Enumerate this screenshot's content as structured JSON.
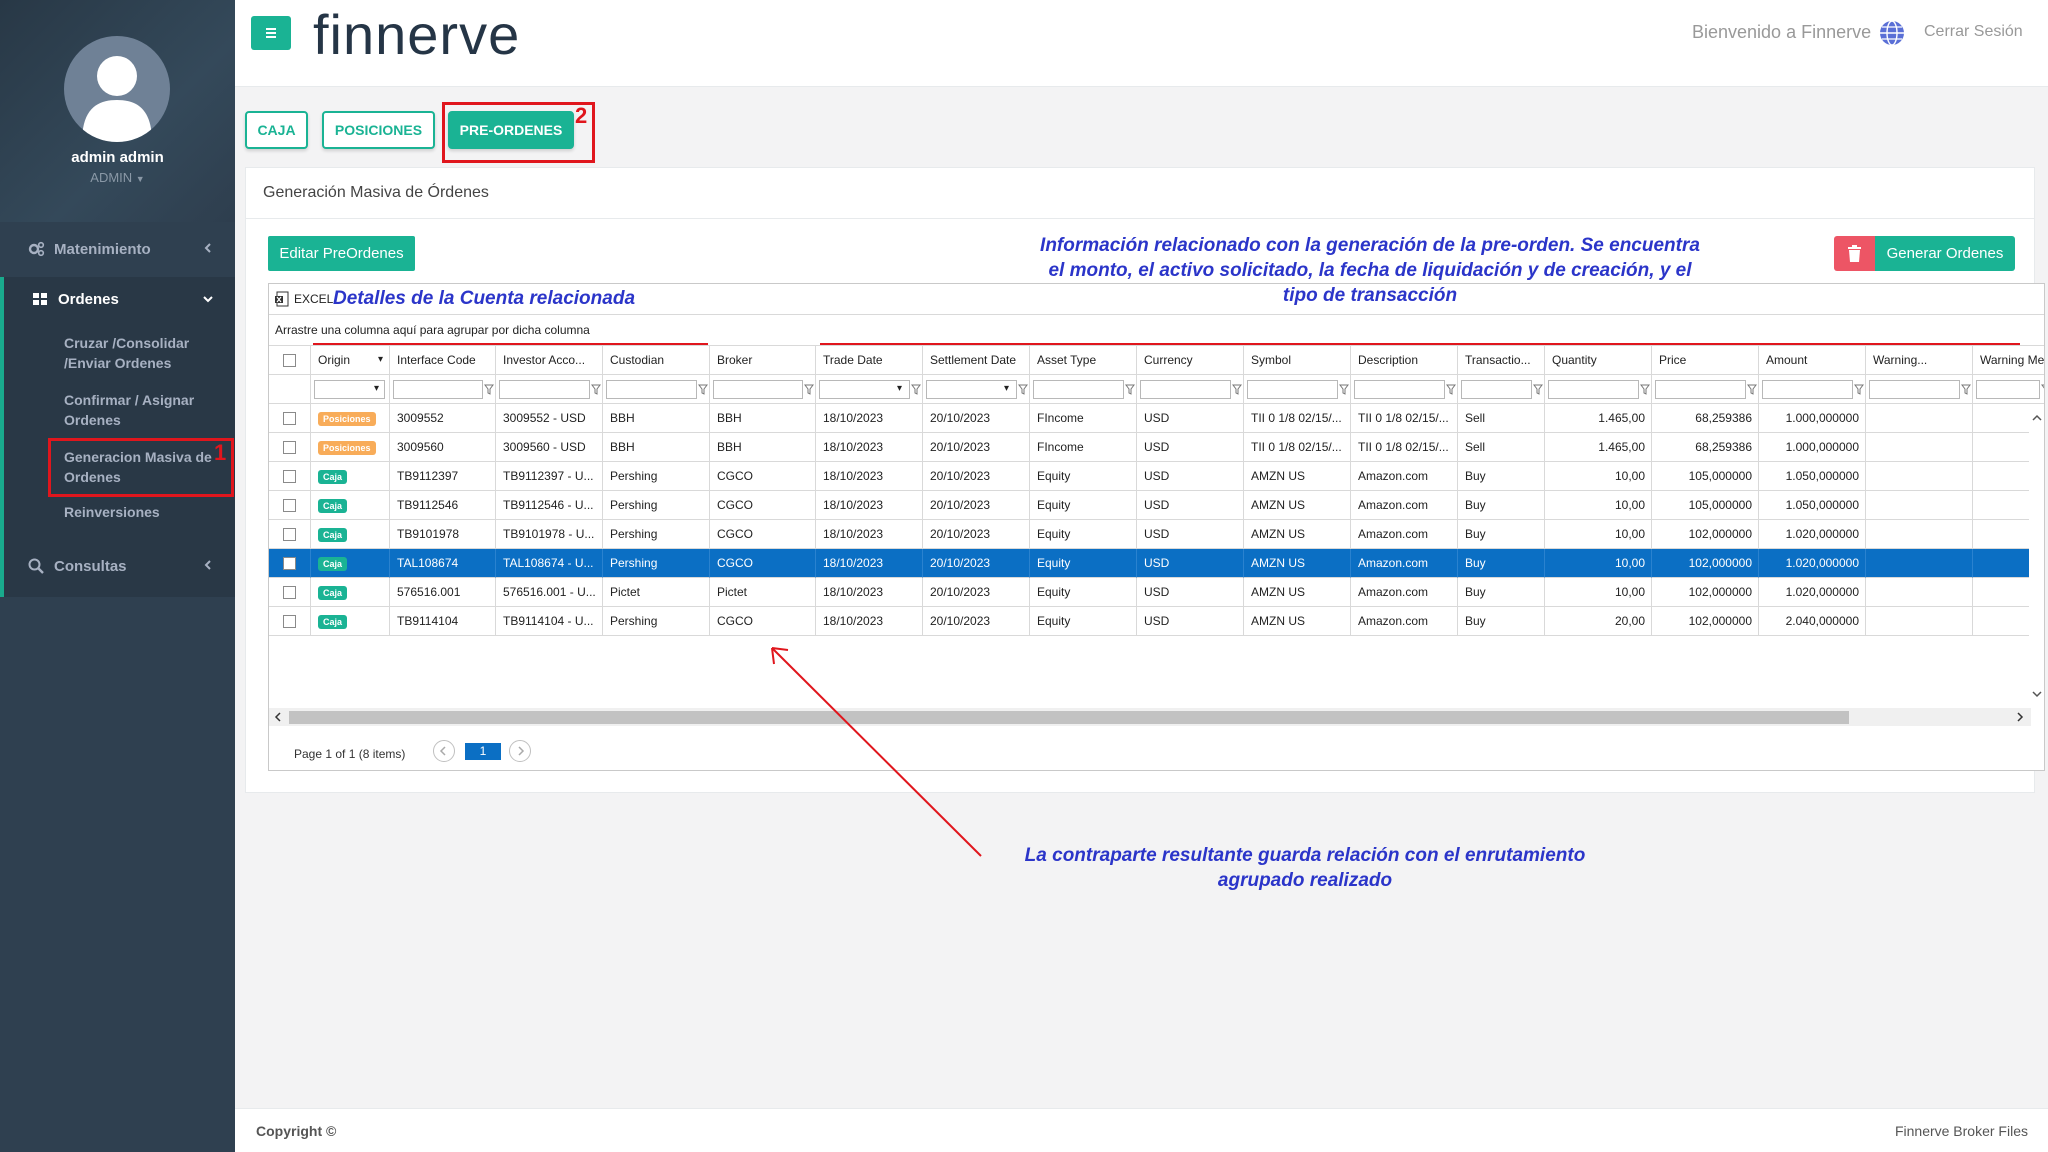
{
  "app": {
    "brand": "finnerve",
    "welcome": "Bienvenido a Finnerve",
    "logout": "Cerrar Sesión"
  },
  "sidebar": {
    "user_name": "admin admin",
    "user_role": "ADMIN",
    "items": [
      {
        "label": "Matenimiento"
      },
      {
        "label": "Ordenes"
      },
      {
        "label": "Consultas"
      }
    ],
    "ordenes_sub": [
      {
        "label": "Cruzar /Consolidar /Enviar Ordenes"
      },
      {
        "label": "Confirmar / Asignar Ordenes"
      },
      {
        "label": "Generacion Masiva de Ordenes"
      },
      {
        "label": "Reinversiones"
      }
    ]
  },
  "tabs": [
    {
      "label": "CAJA"
    },
    {
      "label": "POSICIONES"
    },
    {
      "label": "PRE-ORDENES"
    }
  ],
  "panel": {
    "title": "Generación Masiva de Órdenes",
    "edit_button": "Editar PreOrdenes",
    "generate_button": "Generar Ordenes",
    "excel_label": "EXCEL",
    "group_hint": "Arrastre una columna aquí para agrupar por dicha columna"
  },
  "grid": {
    "columns": [
      "Origin",
      "Interface Code",
      "Investor Acco...",
      "Custodian",
      "Broker",
      "Trade Date",
      "Settlement Date",
      "Asset Type",
      "Currency",
      "Symbol",
      "Description",
      "Transactio...",
      "Quantity",
      "Price",
      "Amount",
      "Warning...",
      "Warning Mess"
    ],
    "rows": [
      {
        "origin": "Posiciones",
        "interface": "3009552",
        "investor": "3009552 - USD",
        "custodian": "BBH",
        "broker": "BBH",
        "trade": "18/10/2023",
        "settle": "20/10/2023",
        "asset": "FIncome",
        "currency": "USD",
        "symbol": "TII 0 1/8 02/15/...",
        "desc": "TII 0 1/8 02/15/...",
        "trans": "Sell",
        "qty": "1.465,00",
        "price": "68,259386",
        "amount": "1.000,000000"
      },
      {
        "origin": "Posiciones",
        "interface": "3009560",
        "investor": "3009560 - USD",
        "custodian": "BBH",
        "broker": "BBH",
        "trade": "18/10/2023",
        "settle": "20/10/2023",
        "asset": "FIncome",
        "currency": "USD",
        "symbol": "TII 0 1/8 02/15/...",
        "desc": "TII 0 1/8 02/15/...",
        "trans": "Sell",
        "qty": "1.465,00",
        "price": "68,259386",
        "amount": "1.000,000000"
      },
      {
        "origin": "Caja",
        "interface": "TB9112397",
        "investor": "TB9112397 - U...",
        "custodian": "Pershing",
        "broker": "CGCO",
        "trade": "18/10/2023",
        "settle": "20/10/2023",
        "asset": "Equity",
        "currency": "USD",
        "symbol": "AMZN US",
        "desc": "Amazon.com",
        "trans": "Buy",
        "qty": "10,00",
        "price": "105,000000",
        "amount": "1.050,000000"
      },
      {
        "origin": "Caja",
        "interface": "TB9112546",
        "investor": "TB9112546 - U...",
        "custodian": "Pershing",
        "broker": "CGCO",
        "trade": "18/10/2023",
        "settle": "20/10/2023",
        "asset": "Equity",
        "currency": "USD",
        "symbol": "AMZN US",
        "desc": "Amazon.com",
        "trans": "Buy",
        "qty": "10,00",
        "price": "105,000000",
        "amount": "1.050,000000"
      },
      {
        "origin": "Caja",
        "interface": "TB9101978",
        "investor": "TB9101978 - U...",
        "custodian": "Pershing",
        "broker": "CGCO",
        "trade": "18/10/2023",
        "settle": "20/10/2023",
        "asset": "Equity",
        "currency": "USD",
        "symbol": "AMZN US",
        "desc": "Amazon.com",
        "trans": "Buy",
        "qty": "10,00",
        "price": "102,000000",
        "amount": "1.020,000000"
      },
      {
        "origin": "Caja",
        "interface": "TAL108674",
        "investor": "TAL108674 - U...",
        "custodian": "Pershing",
        "broker": "CGCO",
        "trade": "18/10/2023",
        "settle": "20/10/2023",
        "asset": "Equity",
        "currency": "USD",
        "symbol": "AMZN US",
        "desc": "Amazon.com",
        "trans": "Buy",
        "qty": "10,00",
        "price": "102,000000",
        "amount": "1.020,000000"
      },
      {
        "origin": "Caja",
        "interface": "576516.001",
        "investor": "576516.001 - U...",
        "custodian": "Pictet",
        "broker": "Pictet",
        "trade": "18/10/2023",
        "settle": "20/10/2023",
        "asset": "Equity",
        "currency": "USD",
        "symbol": "AMZN US",
        "desc": "Amazon.com",
        "trans": "Buy",
        "qty": "10,00",
        "price": "102,000000",
        "amount": "1.020,000000"
      },
      {
        "origin": "Caja",
        "interface": "TB9114104",
        "investor": "TB9114104 - U...",
        "custodian": "Pershing",
        "broker": "CGCO",
        "trade": "18/10/2023",
        "settle": "20/10/2023",
        "asset": "Equity",
        "currency": "USD",
        "symbol": "AMZN US",
        "desc": "Amazon.com",
        "trans": "Buy",
        "qty": "20,00",
        "price": "102,000000",
        "amount": "2.040,000000"
      }
    ],
    "selected_row": 6,
    "pager_text": "Page 1 of 1 (8 items)",
    "current_page": "1"
  },
  "annotations": {
    "marker_1": "1",
    "marker_2": "2",
    "account_details": "Detalles de la Cuenta relacionada",
    "preorder_info": "Información relacionado con la generación de la pre-orden. Se encuentra el monto, el activo solicitado, la fecha de liquidación y de creación, y el tipo de transacción",
    "counterparty": "La contraparte resultante guarda relación con el enrutamiento agrupado realizado"
  },
  "footer": {
    "left": "Copyright ©",
    "right": "Finnerve Broker Files"
  },
  "colors": {
    "accent": "#1ab394",
    "sidebar": "#2f4050",
    "danger": "#ed5565",
    "selection": "#0b6fc4",
    "annotation": "#2b35c9",
    "highlight": "#e0161d"
  }
}
